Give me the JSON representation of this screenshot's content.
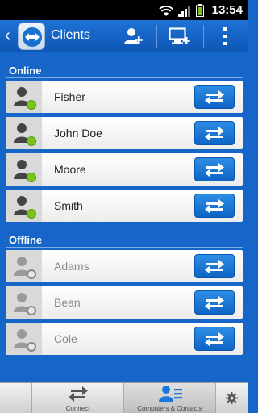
{
  "statusbar": {
    "time": "13:54"
  },
  "actionbar": {
    "title": "Clients"
  },
  "sections": {
    "online_label": "Online",
    "offline_label": "Offline"
  },
  "online": [
    {
      "name": "Fisher"
    },
    {
      "name": "John Doe"
    },
    {
      "name": "Moore"
    },
    {
      "name": "Smith"
    }
  ],
  "offline": [
    {
      "name": "Adams"
    },
    {
      "name": "Bean"
    },
    {
      "name": "Cole"
    }
  ],
  "bottomnav": {
    "connect_label": "Connect",
    "contacts_label": "Computers & Contacts"
  },
  "colors": {
    "background": "#1566c8",
    "online_status": "#7ac41c",
    "connect_button": "#1a78d8"
  }
}
